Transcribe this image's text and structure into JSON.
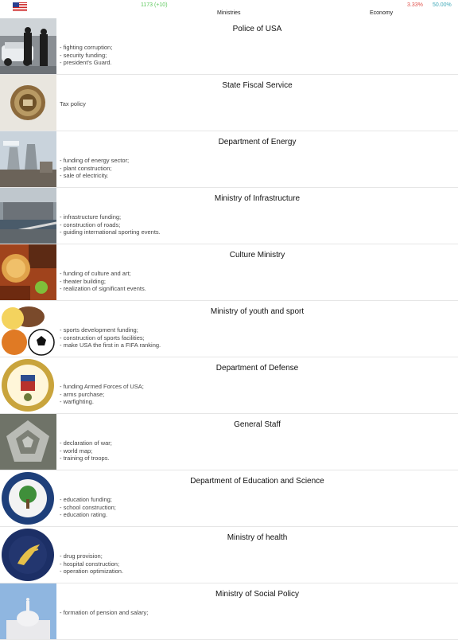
{
  "header": {
    "flag_icon": "us-flag-icon",
    "money": "1173 (+10)",
    "tab_ministries": "Ministries",
    "tab_economy": "Economy",
    "stat_red": "3.33%",
    "stat_teal": "50.00%"
  },
  "colors": {
    "money": "#5cc85c",
    "stat_red": "#e0504a",
    "stat_teal": "#3fa9b8"
  },
  "ministries": [
    {
      "name": "Police of USA",
      "image": "police-photo",
      "lines": [
        "- fighting corruption;",
        "- security funding;",
        "- president's Guard."
      ]
    },
    {
      "name": "State Fiscal Service",
      "image": "treasury-seal",
      "lines": [
        "Tax policy"
      ]
    },
    {
      "name": "Department of Energy",
      "image": "power-plant-photo",
      "lines": [
        "- funding of energy sector;",
        "- plant construction;",
        "- sale of electricity."
      ]
    },
    {
      "name": "Ministry of Infrastructure",
      "image": "city-bridge-photo",
      "lines": [
        "- infrastructure funding;",
        "- construction of roads;",
        "- guiding international sporting events."
      ]
    },
    {
      "name": "Culture Ministry",
      "image": "food-culture-photo",
      "lines": [
        "- funding of culture and art;",
        "- theater building;",
        "- realization of significant events."
      ]
    },
    {
      "name": "Ministry of youth and sport",
      "image": "sports-balls-image",
      "lines": [
        "- sports development funding;",
        "- construction of sports facilities;",
        "- make USA the first in a FIFA ranking."
      ]
    },
    {
      "name": "Department of Defense",
      "image": "army-seal",
      "lines": [
        "- funding Armed Forces of USA;",
        "- arms purchase;",
        "- warfighting."
      ]
    },
    {
      "name": "General Staff",
      "image": "pentagon-photo",
      "lines": [
        "- declaration of war;",
        "- world map;",
        "- training of troops."
      ]
    },
    {
      "name": "Department of Education and Science",
      "image": "education-seal",
      "lines": [
        "- education funding;",
        "- school construction;",
        "- education rating."
      ]
    },
    {
      "name": "Ministry of health",
      "image": "health-seal",
      "lines": [
        "- drug provision;",
        "- hospital construction;",
        "- operation optimization."
      ]
    },
    {
      "name": "Ministry of Social Policy",
      "image": "capitol-photo",
      "lines": [
        "- formation of pension and salary;"
      ]
    }
  ]
}
